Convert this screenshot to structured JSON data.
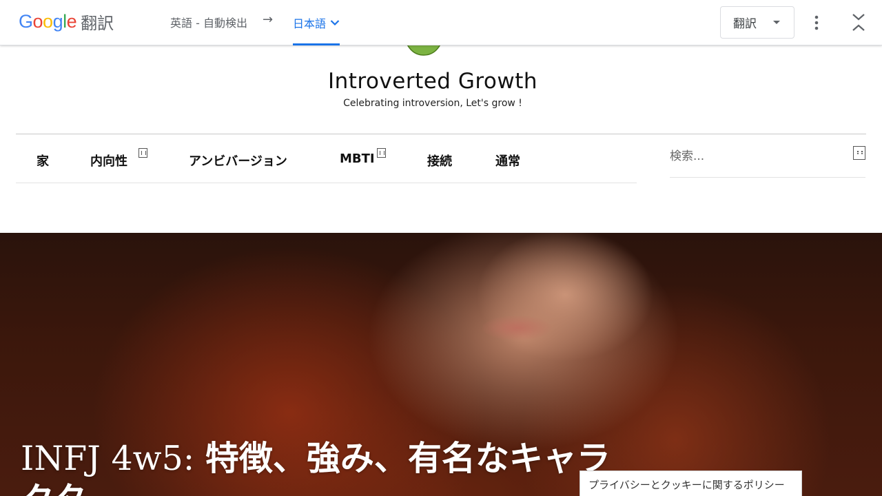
{
  "translate_bar": {
    "logo_letters": [
      "G",
      "o",
      "o",
      "g",
      "l",
      "e"
    ],
    "logo_suffix": "翻訳",
    "source_language": "英語 - 自動検出",
    "arrow": "→",
    "target_language": "日本語",
    "translate_button": "翻訳",
    "icons": [
      "chevron-down-icon",
      "more-vert-icon",
      "collapse-icon"
    ],
    "colors": {
      "accent": "#1a73e8",
      "google_blue": "#4285F4",
      "google_red": "#EA4335",
      "google_yellow": "#FBBC05",
      "google_green": "#34A853"
    }
  },
  "site": {
    "title": "Introverted Growth",
    "tagline": "Celebrating introversion, Let's grow !",
    "logo_color": "#7cb342"
  },
  "nav": {
    "items": [
      {
        "label": "家",
        "has_submenu": false
      },
      {
        "label": "内向性",
        "has_submenu": true
      },
      {
        "label": "アンビバージョン",
        "has_submenu": false
      },
      {
        "label": "MBTI",
        "has_submenu": true
      },
      {
        "label": "接続",
        "has_submenu": false
      },
      {
        "label": "通常",
        "has_submenu": false
      }
    ]
  },
  "search": {
    "placeholder": "検索..."
  },
  "hero": {
    "title_latin": "INFJ 4w5: ",
    "title_rest": "特徴、強み、有名なキャラクタ"
  },
  "privacy": {
    "label": "プライバシーとクッキーに関するポリシー"
  }
}
